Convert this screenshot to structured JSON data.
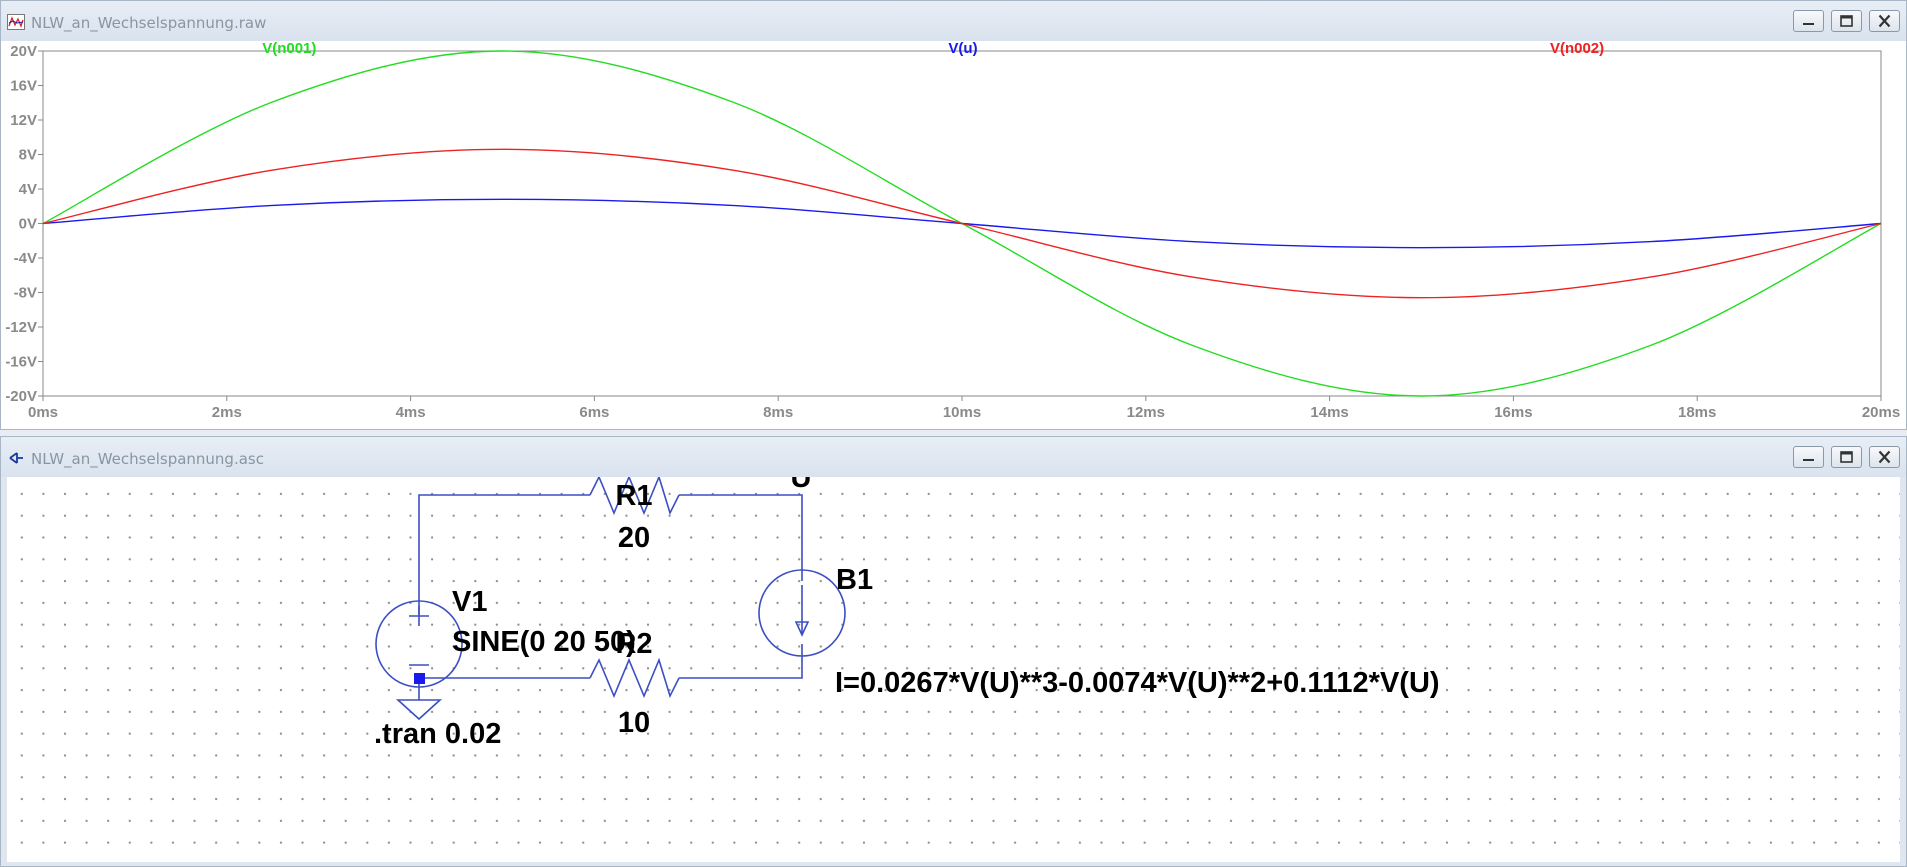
{
  "waveform_window": {
    "title": "NLW_an_Wechselspannung.raw",
    "icon": "waveform-viewer-icon",
    "controls": [
      "minimize-icon",
      "maximize-icon",
      "close-icon"
    ]
  },
  "schematic_window": {
    "title": "NLW_an_Wechselspannung.asc",
    "icon": "schematic-editor-icon",
    "controls": [
      "minimize-icon",
      "maximize-icon",
      "close-icon"
    ]
  },
  "colors": {
    "v_n001": "#22dd22",
    "v_u": "#1a1aee",
    "v_n002": "#ee2222",
    "wire": "#3c4fc2",
    "component_text": "#000000"
  },
  "chart_data": {
    "type": "line",
    "x_unit": "ms",
    "xlim": [
      0,
      20
    ],
    "ylim": [
      -20,
      20
    ],
    "x_ticks": [
      "0ms",
      "2ms",
      "4ms",
      "6ms",
      "8ms",
      "10ms",
      "12ms",
      "14ms",
      "16ms",
      "18ms",
      "20ms"
    ],
    "y_ticks": [
      "20V",
      "16V",
      "12V",
      "8V",
      "4V",
      "0V",
      "-4V",
      "-8V",
      "-12V",
      "-16V",
      "-20V"
    ],
    "grid": false,
    "series": [
      {
        "name": "V(n001)",
        "color": "#22dd22",
        "x": [
          0,
          2.5,
          5,
          7.5,
          10,
          12.5,
          15,
          17.5,
          20
        ],
        "y": [
          0,
          14.1,
          20,
          14.1,
          0,
          -14.1,
          -20,
          -14.1,
          0
        ]
      },
      {
        "name": "V(u)",
        "color": "#1a1aee",
        "x": [
          0,
          2.5,
          5,
          7.5,
          10,
          12.5,
          15,
          17.5,
          20
        ],
        "y": [
          0,
          2.1,
          2.8,
          2.1,
          0,
          -2.1,
          -2.8,
          -2.1,
          0
        ]
      },
      {
        "name": "V(n002)",
        "color": "#ee2222",
        "x": [
          0,
          2.5,
          5,
          7.5,
          10,
          12.5,
          15,
          17.5,
          20
        ],
        "y": [
          0,
          6.2,
          8.6,
          6.2,
          0,
          -6.2,
          -8.6,
          -6.2,
          0
        ]
      }
    ]
  },
  "schematic": {
    "r1": {
      "name": "R1",
      "value": "20"
    },
    "r2": {
      "name": "R2",
      "value": "10"
    },
    "v1": {
      "name": "V1",
      "value": "SINE(0 20 50)"
    },
    "b1": {
      "name": "B1",
      "value": "I=0.0267*V(U)**3-0.0074*V(U)**2+0.1112*V(U)"
    },
    "node_u": "U",
    "directive": ".tran 0.02"
  }
}
